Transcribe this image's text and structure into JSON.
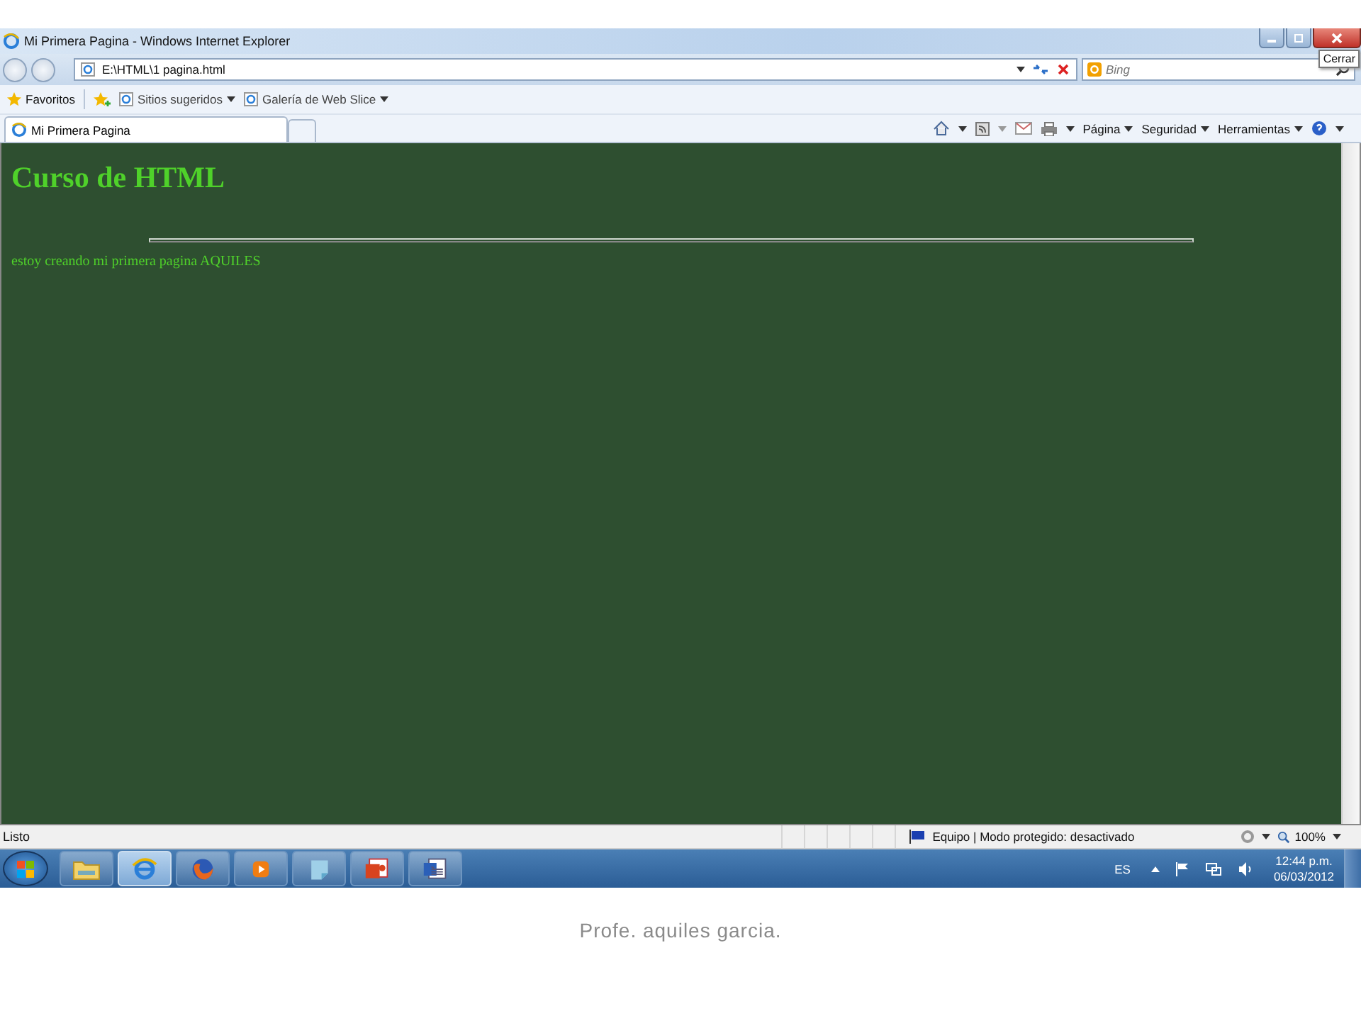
{
  "window": {
    "title": "Mi Primera Pagina - Windows Internet Explorer",
    "close_tooltip": "Cerrar"
  },
  "address_bar": {
    "value": "E:\\HTML\\1 pagina.html"
  },
  "search": {
    "placeholder": "Bing"
  },
  "favorites_bar": {
    "label": "Favoritos",
    "links": [
      "Sitios sugeridos",
      "Galería de Web Slice"
    ]
  },
  "tabs": [
    {
      "label": "Mi Primera Pagina",
      "selected": true
    }
  ],
  "command_bar": {
    "menus": [
      "Página",
      "Seguridad",
      "Herramientas"
    ]
  },
  "page": {
    "heading": "Curso de HTML",
    "paragraph": "estoy creando mi primera pagina AQUILES"
  },
  "status_bar": {
    "text": "Listo",
    "zone": "Equipo | Modo protegido: desactivado",
    "zoom": "100%"
  },
  "taskbar": {
    "apps": [
      {
        "kind": "folder",
        "selected": false
      },
      {
        "kind": "browser-e",
        "selected": true
      },
      {
        "kind": "browser-fox",
        "selected": false
      },
      {
        "kind": "player",
        "selected": false
      },
      {
        "kind": "notes",
        "selected": false
      },
      {
        "kind": "slides",
        "selected": false
      },
      {
        "kind": "document",
        "selected": false
      }
    ],
    "language": "ES",
    "time": "12:44 p.m.",
    "date": "06/03/2012"
  },
  "caption": "Profe. aquiles garcia."
}
